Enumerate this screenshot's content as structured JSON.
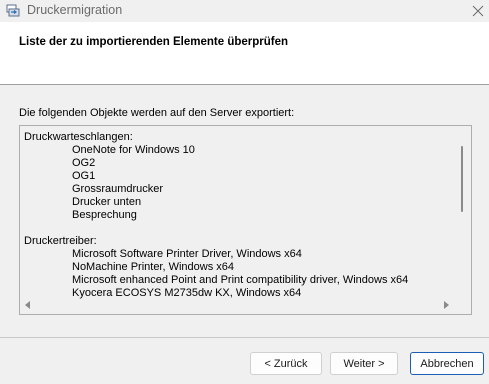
{
  "window": {
    "title": "Druckermigration"
  },
  "header": {
    "heading": "Liste der zu importierenden Elemente überprüfen"
  },
  "main": {
    "description": "Die folgenden Objekte werden auf den Server exportiert:",
    "groups": [
      {
        "label": "Druckwarteschlangen:",
        "items": [
          "OneNote for Windows 10",
          "OG2",
          "OG1",
          "Grossraumdrucker",
          "Drucker unten",
          "Besprechung"
        ]
      },
      {
        "label": "Druckertreiber:",
        "items": [
          "Microsoft Software Printer Driver, Windows x64",
          "NoMachine Printer, Windows x64",
          "Microsoft enhanced Point and Print compatibility driver, Windows x64",
          "Kyocera ECOSYS M2735dw KX, Windows x64"
        ]
      }
    ]
  },
  "footer": {
    "back_label": "< Zurück",
    "next_label": "Weiter >",
    "cancel_label": "Abbrechen"
  },
  "colors": {
    "header_bg": "#ffffff",
    "window_bg": "#f0f0f0",
    "default_button_border": "#1a5fb4"
  },
  "icons": {
    "app": "printer-migration-icon",
    "close": "close-icon"
  }
}
